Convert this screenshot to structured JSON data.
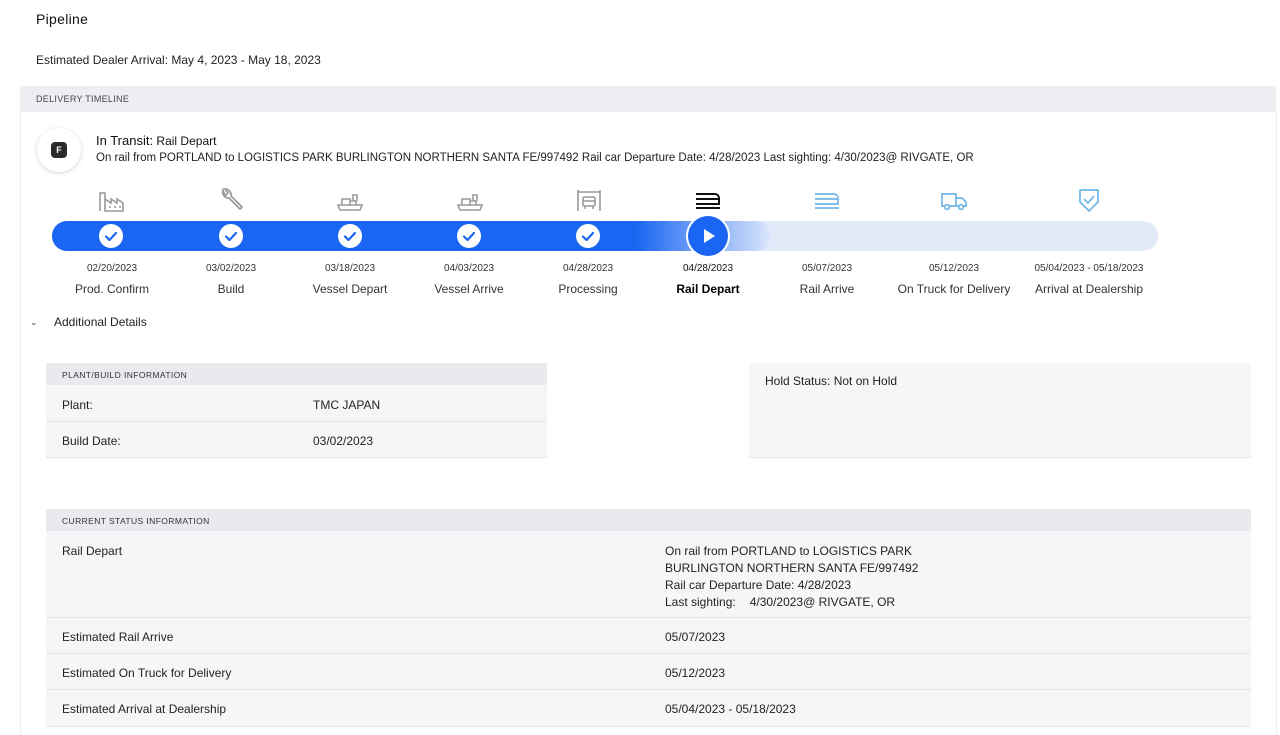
{
  "page": {
    "title": "Pipeline",
    "eta_label": "Estimated Dealer Arrival:",
    "eta_value": "May 4, 2023 - May 18, 2023"
  },
  "timeline": {
    "header": "DELIVERY TIMELINE",
    "badge_letter": "F",
    "status_prefix": "In Transit:",
    "status_stage": "Rail Depart",
    "status_detail": "On rail from PORTLAND to LOGISTICS PARK BURLINGTON NORTHERN SANTA FE/997492 Rail car Departure Date: 4/28/2023 Last sighting: 4/30/2023@ RIVGATE, OR",
    "progress_fraction": 0.56,
    "steps": [
      {
        "date": "02/20/2023",
        "label": "Prod. Confirm",
        "state": "complete",
        "icon": "factory-icon"
      },
      {
        "date": "03/02/2023",
        "label": "Build",
        "state": "complete",
        "icon": "wrench-icon"
      },
      {
        "date": "03/18/2023",
        "label": "Vessel Depart",
        "state": "complete",
        "icon": "ship-icon"
      },
      {
        "date": "04/03/2023",
        "label": "Vessel Arrive",
        "state": "complete",
        "icon": "ship-icon"
      },
      {
        "date": "04/28/2023",
        "label": "Processing",
        "state": "complete",
        "icon": "processing-icon"
      },
      {
        "date": "04/28/2023",
        "label": "Rail Depart",
        "state": "current",
        "icon": "rail-icon"
      },
      {
        "date": "05/07/2023",
        "label": "Rail Arrive",
        "state": "upcoming",
        "icon": "rail-icon"
      },
      {
        "date": "05/12/2023",
        "label": "On Truck for Delivery",
        "state": "upcoming",
        "icon": "truck-icon"
      },
      {
        "date": "05/04/2023 - 05/18/2023",
        "label": "Arrival at Dealership",
        "state": "upcoming",
        "icon": "shield-check-icon"
      }
    ]
  },
  "additional_details": {
    "toggle_label": "Additional Details",
    "plant_build": {
      "header": "PLANT/BUILD INFORMATION",
      "rows": [
        {
          "key": "Plant:",
          "value": "TMC JAPAN"
        },
        {
          "key": "Build Date:",
          "value": "03/02/2023"
        }
      ]
    },
    "hold_status": "Hold Status: Not on Hold",
    "current_status": {
      "header": "CURRENT STATUS INFORMATION",
      "rail_depart_key": "Rail Depart",
      "rail_depart_lines": [
        "On rail from PORTLAND to LOGISTICS PARK",
        "BURLINGTON NORTHERN SANTA FE/997492",
        "Rail car Departure Date: 4/28/2023"
      ],
      "last_sighting_label": "Last sighting:",
      "last_sighting_value": "4/30/2023@ RIVGATE, OR",
      "rows": [
        {
          "key": "Estimated Rail Arrive",
          "value": "05/07/2023"
        },
        {
          "key": "Estimated On Truck for Delivery",
          "value": "05/12/2023"
        },
        {
          "key": "Estimated Arrival at Dealership",
          "value": "05/04/2023 - 05/18/2023"
        }
      ]
    }
  },
  "colors": {
    "accent": "#1a66f2",
    "track_light": "#e2e9f8",
    "icon_done": "#9a9a9a",
    "icon_current": "#111111",
    "icon_upcoming": "#6fb6e6"
  }
}
